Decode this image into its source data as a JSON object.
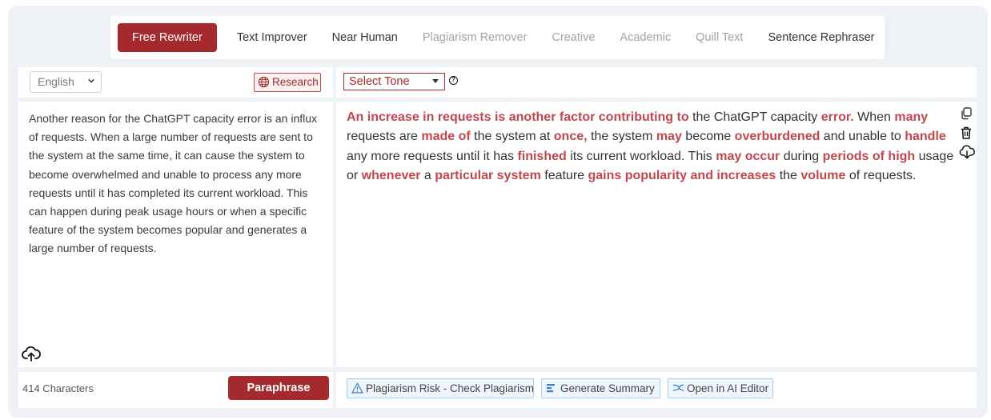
{
  "tabs": [
    {
      "label": "Free Rewriter",
      "state": "active"
    },
    {
      "label": "Text Improver",
      "state": "normal"
    },
    {
      "label": "Near Human",
      "state": "normal"
    },
    {
      "label": "Plagiarism Remover",
      "state": "muted"
    },
    {
      "label": "Creative",
      "state": "muted"
    },
    {
      "label": "Academic",
      "state": "muted"
    },
    {
      "label": "Quill Text",
      "state": "muted"
    },
    {
      "label": "Sentence Rephraser",
      "state": "normal"
    }
  ],
  "input_panel": {
    "language": "English",
    "research_label": "Research",
    "text": "Another reason for the ChatGPT capacity error is an influx of requests. When a large number of requests are sent to the system at the same time, it can cause the system to become overwhelmed and unable to process any more requests until it has completed its current workload. This can happen during peak usage hours or when a specific feature of the system becomes popular and generates a large number of requests.",
    "char_count": "414 Characters",
    "paraphrase_label": "Paraphrase"
  },
  "output_panel": {
    "tone_label": "Select Tone",
    "help_symbol": "?",
    "segments": [
      {
        "t": "An increase in requests is another factor contributing to",
        "h": true
      },
      {
        "t": " the ChatGPT capacity ",
        "h": false
      },
      {
        "t": "error.",
        "h": true
      },
      {
        "t": " When ",
        "h": false
      },
      {
        "t": "many",
        "h": true
      },
      {
        "t": " requests are ",
        "h": false
      },
      {
        "t": "made of",
        "h": true
      },
      {
        "t": " the system at ",
        "h": false
      },
      {
        "t": "once,",
        "h": true
      },
      {
        "t": " the system ",
        "h": false
      },
      {
        "t": "may",
        "h": true
      },
      {
        "t": " become ",
        "h": false
      },
      {
        "t": "overburdened",
        "h": true
      },
      {
        "t": " and unable to ",
        "h": false
      },
      {
        "t": "handle",
        "h": true
      },
      {
        "t": " any more requests until it has ",
        "h": false
      },
      {
        "t": "finished",
        "h": true
      },
      {
        "t": " its current workload. This ",
        "h": false
      },
      {
        "t": "may occur",
        "h": true
      },
      {
        "t": " during ",
        "h": false
      },
      {
        "t": "periods of high",
        "h": true
      },
      {
        "t": " usage or ",
        "h": false
      },
      {
        "t": "whenever",
        "h": true
      },
      {
        "t": " a ",
        "h": false
      },
      {
        "t": "particular system",
        "h": true
      },
      {
        "t": " feature ",
        "h": false
      },
      {
        "t": "gains popularity and increases",
        "h": true
      },
      {
        "t": " the ",
        "h": false
      },
      {
        "t": "volume",
        "h": true
      },
      {
        "t": " of requests.",
        "h": false
      }
    ],
    "actions": {
      "plagiarism": "Plagiarism Risk - Check Plagiarism",
      "summary": "Generate Summary",
      "editor": "Open in AI Editor"
    }
  },
  "icons": {
    "copy": "copy-icon",
    "delete": "trash-icon",
    "download": "cloud-download-icon",
    "upload": "cloud-upload-icon",
    "research": "globe-icon"
  },
  "colors": {
    "accent": "#a52a2e",
    "highlight": "#c0484c",
    "background": "#eef1f6",
    "action_border": "#a9cfee"
  }
}
